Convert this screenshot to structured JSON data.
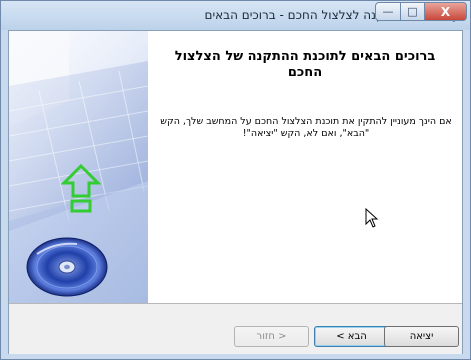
{
  "window": {
    "title": "תוכנת ההתקנה לצלצול החכם - ברוכים הבאים"
  },
  "titlebar_controls": {
    "minimize_glyph": "—",
    "maximize_glyph": "□",
    "close_glyph": "X"
  },
  "content": {
    "heading": "ברוכים הבאים לתוכנת ההתקנה של הצלצול החכם",
    "description": "אם הינך מעוניין להתקין את תוכנת הצלצול החכם על המחשב שלך, הקש \"הבא\", ואם לא, הקש \"יציאה\"!"
  },
  "buttons": {
    "back": "< חזור",
    "next": "הבא >",
    "exit": "יציאה"
  },
  "states": {
    "back_enabled": false,
    "next_default": true
  },
  "icons": {
    "app": "installer-icon",
    "sidebar_arrow": "up-arrow-icon",
    "sidebar_disc": "cd-disc-icon",
    "cursor": "mouse-pointer-icon"
  },
  "colors": {
    "arrow_green": "#33cc33",
    "titlebar": "#c9daee",
    "close_button": "#c8483a"
  }
}
